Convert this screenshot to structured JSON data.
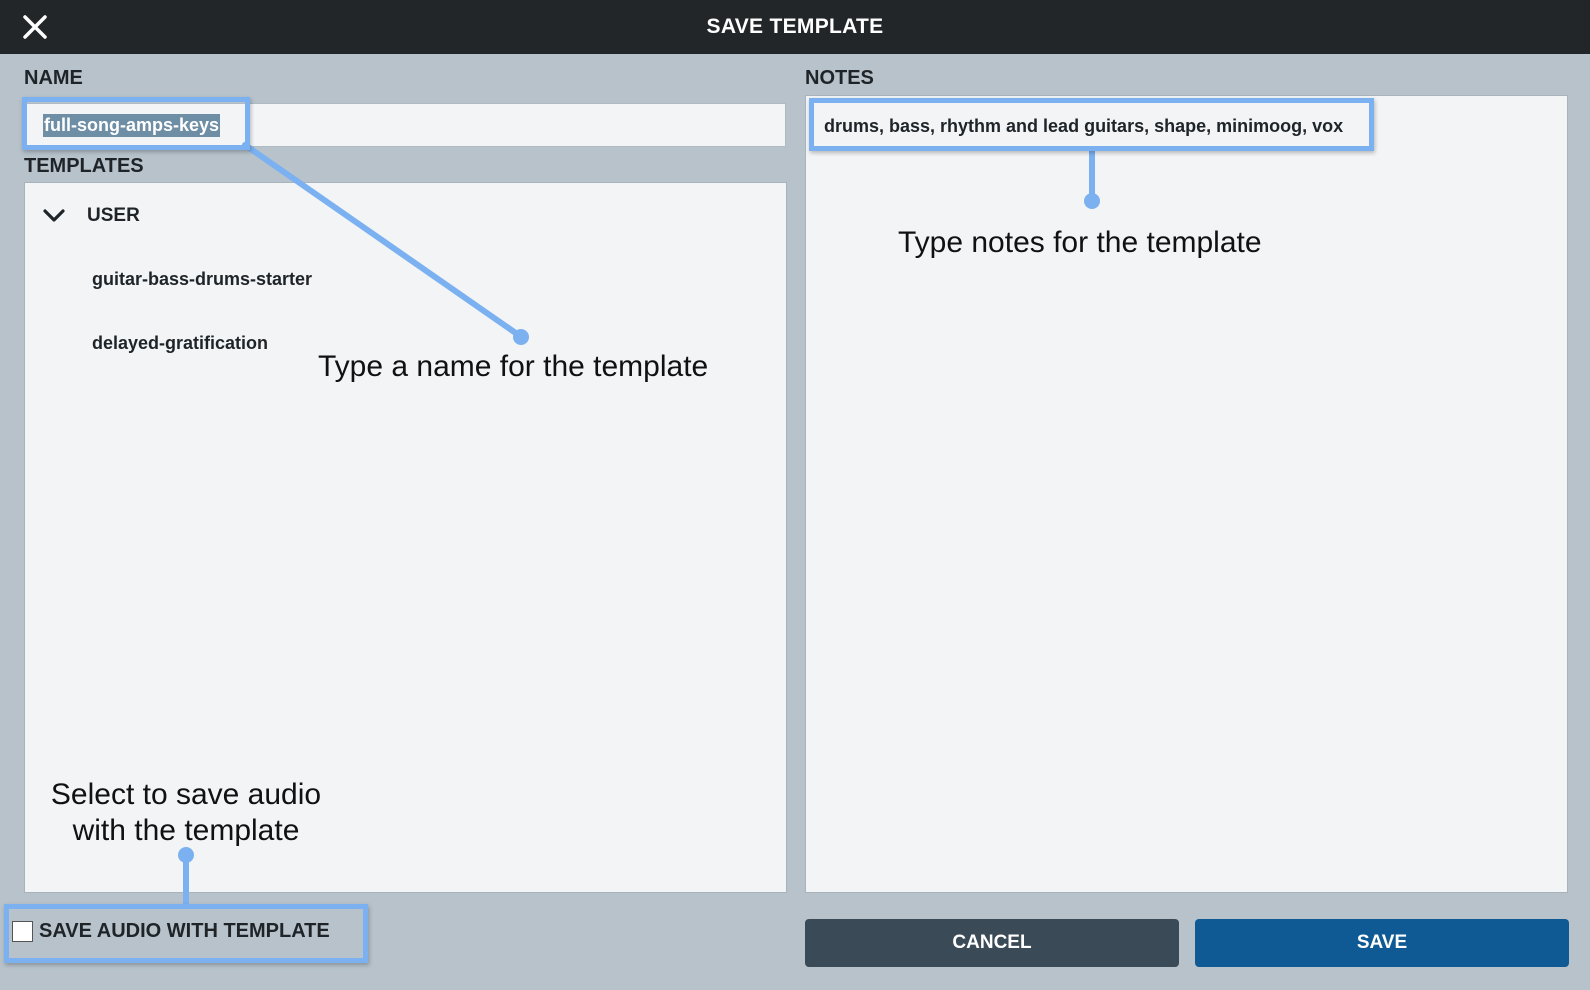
{
  "dialog": {
    "title": "SAVE TEMPLATE",
    "close_icon": "close-icon"
  },
  "name_section": {
    "label": "NAME",
    "value": "full-song-amps-keys"
  },
  "templates_section": {
    "label": "TEMPLATES",
    "group": {
      "label": "USER",
      "icon": "chevron-down-icon",
      "expanded": true
    },
    "items": [
      {
        "label": "guitar-bass-drums-starter"
      },
      {
        "label": "delayed-gratification"
      }
    ]
  },
  "notes_section": {
    "label": "NOTES",
    "value": "drums, bass, rhythm and lead guitars, shape, minimoog, vox"
  },
  "save_audio": {
    "label": "SAVE AUDIO WITH TEMPLATE",
    "checked": false
  },
  "buttons": {
    "cancel_label": "CANCEL",
    "save_label": "SAVE"
  },
  "callouts": {
    "name": "Type a name for the template",
    "notes": "Type notes for the template",
    "audio_line1": "Select to save audio",
    "audio_line2": "with the template"
  },
  "colors": {
    "titlebar": "#232629",
    "background": "#b7c2cb",
    "panel": "#f2f4f6",
    "highlight": "#7bb1f1",
    "cancel_button": "#3a4a57",
    "save_button": "#0f5a94"
  }
}
